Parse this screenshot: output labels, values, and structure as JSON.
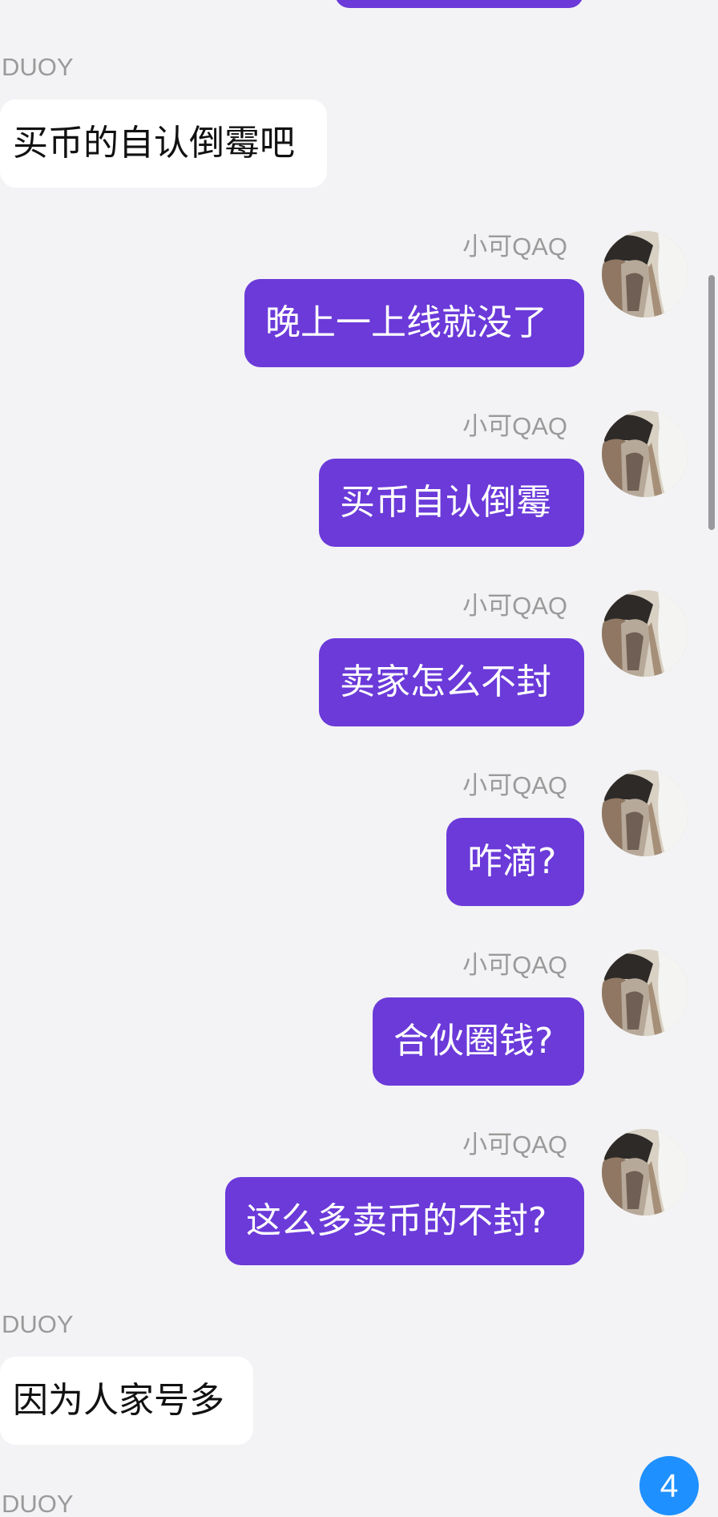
{
  "chat": {
    "colors": {
      "background": "#f3f3f5",
      "outgoing_bubble": "#6b3ad9",
      "incoming_bubble": "#ffffff",
      "name_text": "#9a9a9a",
      "badge": "#1e90ff"
    },
    "messages": [
      {
        "sender": "DUOY",
        "text": "买币的自认倒霉吧",
        "side": "left"
      },
      {
        "sender": "小可QAQ",
        "text": "晚上一上线就没了",
        "side": "right"
      },
      {
        "sender": "小可QAQ",
        "text": "买币自认倒霉",
        "side": "right"
      },
      {
        "sender": "小可QAQ",
        "text": "卖家怎么不封",
        "side": "right"
      },
      {
        "sender": "小可QAQ",
        "text": "咋滴?",
        "side": "right"
      },
      {
        "sender": "小可QAQ",
        "text": "合伙圈钱?",
        "side": "right"
      },
      {
        "sender": "小可QAQ",
        "text": "这么多卖币的不封?",
        "side": "right"
      },
      {
        "sender": "DUOY",
        "text": "因为人家号多",
        "side": "left"
      }
    ],
    "bottom_sender": "DUOY",
    "unread_count": "4"
  }
}
